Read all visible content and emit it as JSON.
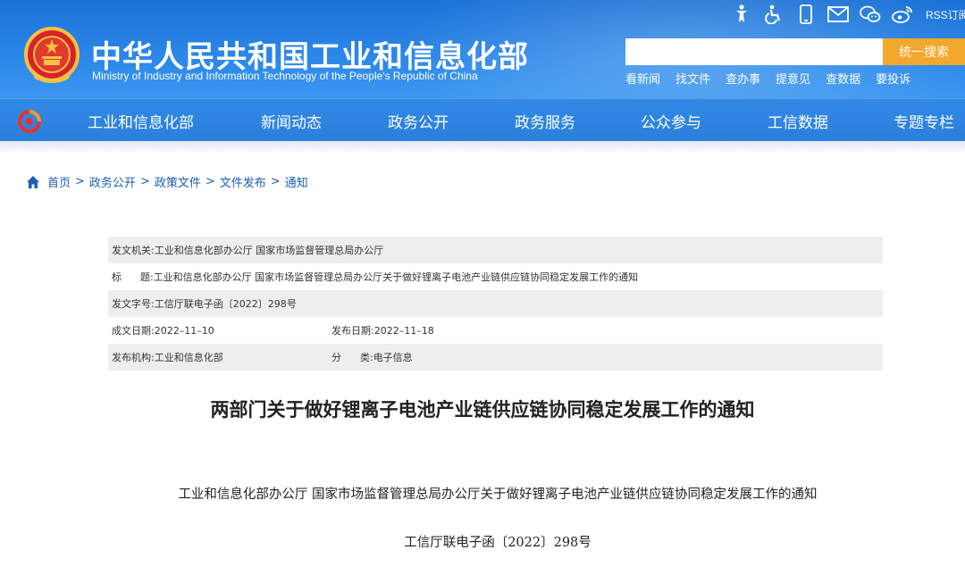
{
  "header": {
    "site_title": "中华人民共和国工业和信息化部",
    "site_subtitle": "Ministry of Industry and Information Technology of the People's Republic of China",
    "rss_label": "RSS订阅",
    "search": {
      "placeholder": "",
      "button_label": "统一搜索"
    },
    "quick_links": [
      "看新闻",
      "找文件",
      "查办事",
      "提意见",
      "查数据",
      "要投诉"
    ],
    "utility_icons": [
      "accessibility-figure-icon",
      "wheelchair-icon",
      "mobile-phone-icon",
      "mail-icon",
      "wechat-icon",
      "weibo-icon"
    ],
    "colors": {
      "header_blue": "#2a86e8",
      "search_button": "#f3a72c"
    }
  },
  "nav": {
    "items": [
      "工业和信息化部",
      "新闻动态",
      "政务公开",
      "政务服务",
      "公众参与",
      "工信数据",
      "专题专栏"
    ]
  },
  "breadcrumb": {
    "items": [
      "首页",
      "政务公开",
      "政策文件",
      "文件发布",
      "通知"
    ],
    "separator": ">"
  },
  "meta": {
    "issuer_label": "发文机关:",
    "issuer_value": "工业和信息化部办公厅 国家市场监督管理总局办公厅",
    "title_label": "标      题:",
    "title_value": "工业和信息化部办公厅 国家市场监督管理总局办公厅关于做好锂离子电池产业链供应链协同稳定发展工作的通知",
    "doc_no_label": "发文字号:",
    "doc_no_value": "工信厅联电子函〔2022〕298号",
    "date_written_label": "成文日期:",
    "date_written_value": "2022–11–10",
    "date_published_label": "发布日期:",
    "date_published_value": "2022–11–18",
    "publisher_label": "发布机构:",
    "publisher_value": "工业和信息化部",
    "category_label": "分      类:",
    "category_value": "电子信息"
  },
  "article": {
    "title": "两部门关于做好锂离子电池产业链供应链协同稳定发展工作的通知",
    "subtitle": "工业和信息化部办公厅 国家市场监督管理总局办公厅关于做好锂离子电池产业链供应链协同稳定发展工作的通知",
    "doc_number": "工信厅联电子函〔2022〕298号"
  }
}
